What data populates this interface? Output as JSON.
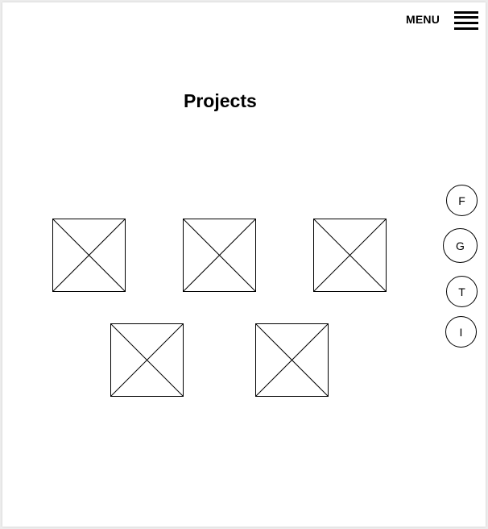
{
  "header": {
    "menu_label": "MENU"
  },
  "page": {
    "title": "Projects"
  },
  "projects": [
    {
      "icon": "image-placeholder-icon"
    },
    {
      "icon": "image-placeholder-icon"
    },
    {
      "icon": "image-placeholder-icon"
    },
    {
      "icon": "image-placeholder-icon"
    },
    {
      "icon": "image-placeholder-icon"
    }
  ],
  "social": [
    {
      "label": "F"
    },
    {
      "label": "G"
    },
    {
      "label": "T"
    },
    {
      "label": "I"
    }
  ]
}
